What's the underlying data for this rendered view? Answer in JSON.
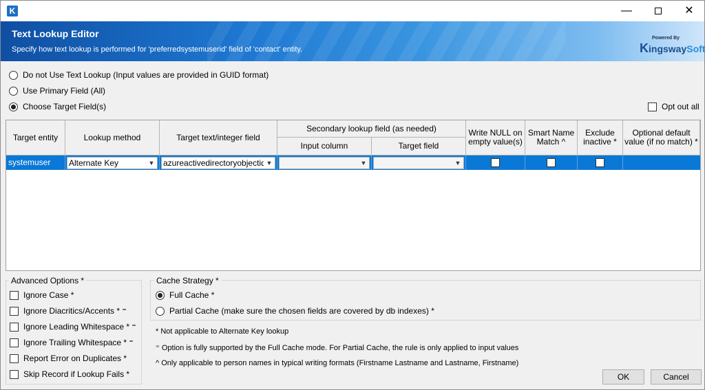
{
  "app_icon": "K",
  "window_controls": {
    "minimize": "—",
    "close": "✕"
  },
  "banner": {
    "title": "Text Lookup Editor",
    "subtitle": "Specify how text lookup is performed for 'preferredsystemuserid' field of 'contact' entity.",
    "logo_powered": "Powered By",
    "logo_k": "K",
    "logo_ingsway": "ingsway",
    "logo_soft": "Soft"
  },
  "options": {
    "no_text_lookup": "Do not Use Text Lookup (Input values are provided in GUID format)",
    "primary_field": "Use Primary Field (All)",
    "choose_target": "Choose Target Field(s)",
    "selected": "choose_target",
    "opt_out_all": "Opt out all"
  },
  "grid": {
    "headers": {
      "target_entity": "Target entity",
      "lookup_method": "Lookup method",
      "target_field": "Target text/integer field",
      "secondary": "Secondary lookup field (as needed)",
      "input_column": "Input column",
      "secondary_target_field": "Target field",
      "write_null": "Write NULL on empty value(s)",
      "smart_name": "Smart Name Match ^",
      "exclude_inactive": "Exclude inactive *",
      "optional_default": "Optional default value (if no match) *"
    },
    "rows": [
      {
        "target_entity": "systemuser",
        "lookup_method": "Alternate Key",
        "target_field": "azureactivedirectoryobjectid (azureactivedirectoryobjectid)",
        "input_column": "",
        "target_field_secondary": "",
        "write_null": false,
        "smart_name": false,
        "exclude_inactive": false,
        "optional_default": ""
      }
    ]
  },
  "advanced": {
    "title": "Advanced Options *",
    "items": [
      "Ignore Case *",
      "Ignore Diacritics/Accents * ⁼",
      "Ignore Leading Whitespace * ⁼",
      "Ignore Trailing Whitespace * ⁼",
      "Report Error on Duplicates *",
      "Skip Record if Lookup Fails *"
    ]
  },
  "cache": {
    "title": "Cache Strategy *",
    "full": "Full Cache *",
    "partial": "Partial Cache (make sure the chosen fields are covered by db indexes) *",
    "selected": "full"
  },
  "notes": [
    "* Not applicable to Alternate Key lookup",
    "⁼ Option is fully supported by the Full Cache mode. For Partial Cache, the rule is only applied to input values",
    "^ Only applicable to person names in typical writing formats (Firstname Lastname and Lastname, Firstname)"
  ],
  "buttons": {
    "ok": "OK",
    "cancel": "Cancel"
  }
}
